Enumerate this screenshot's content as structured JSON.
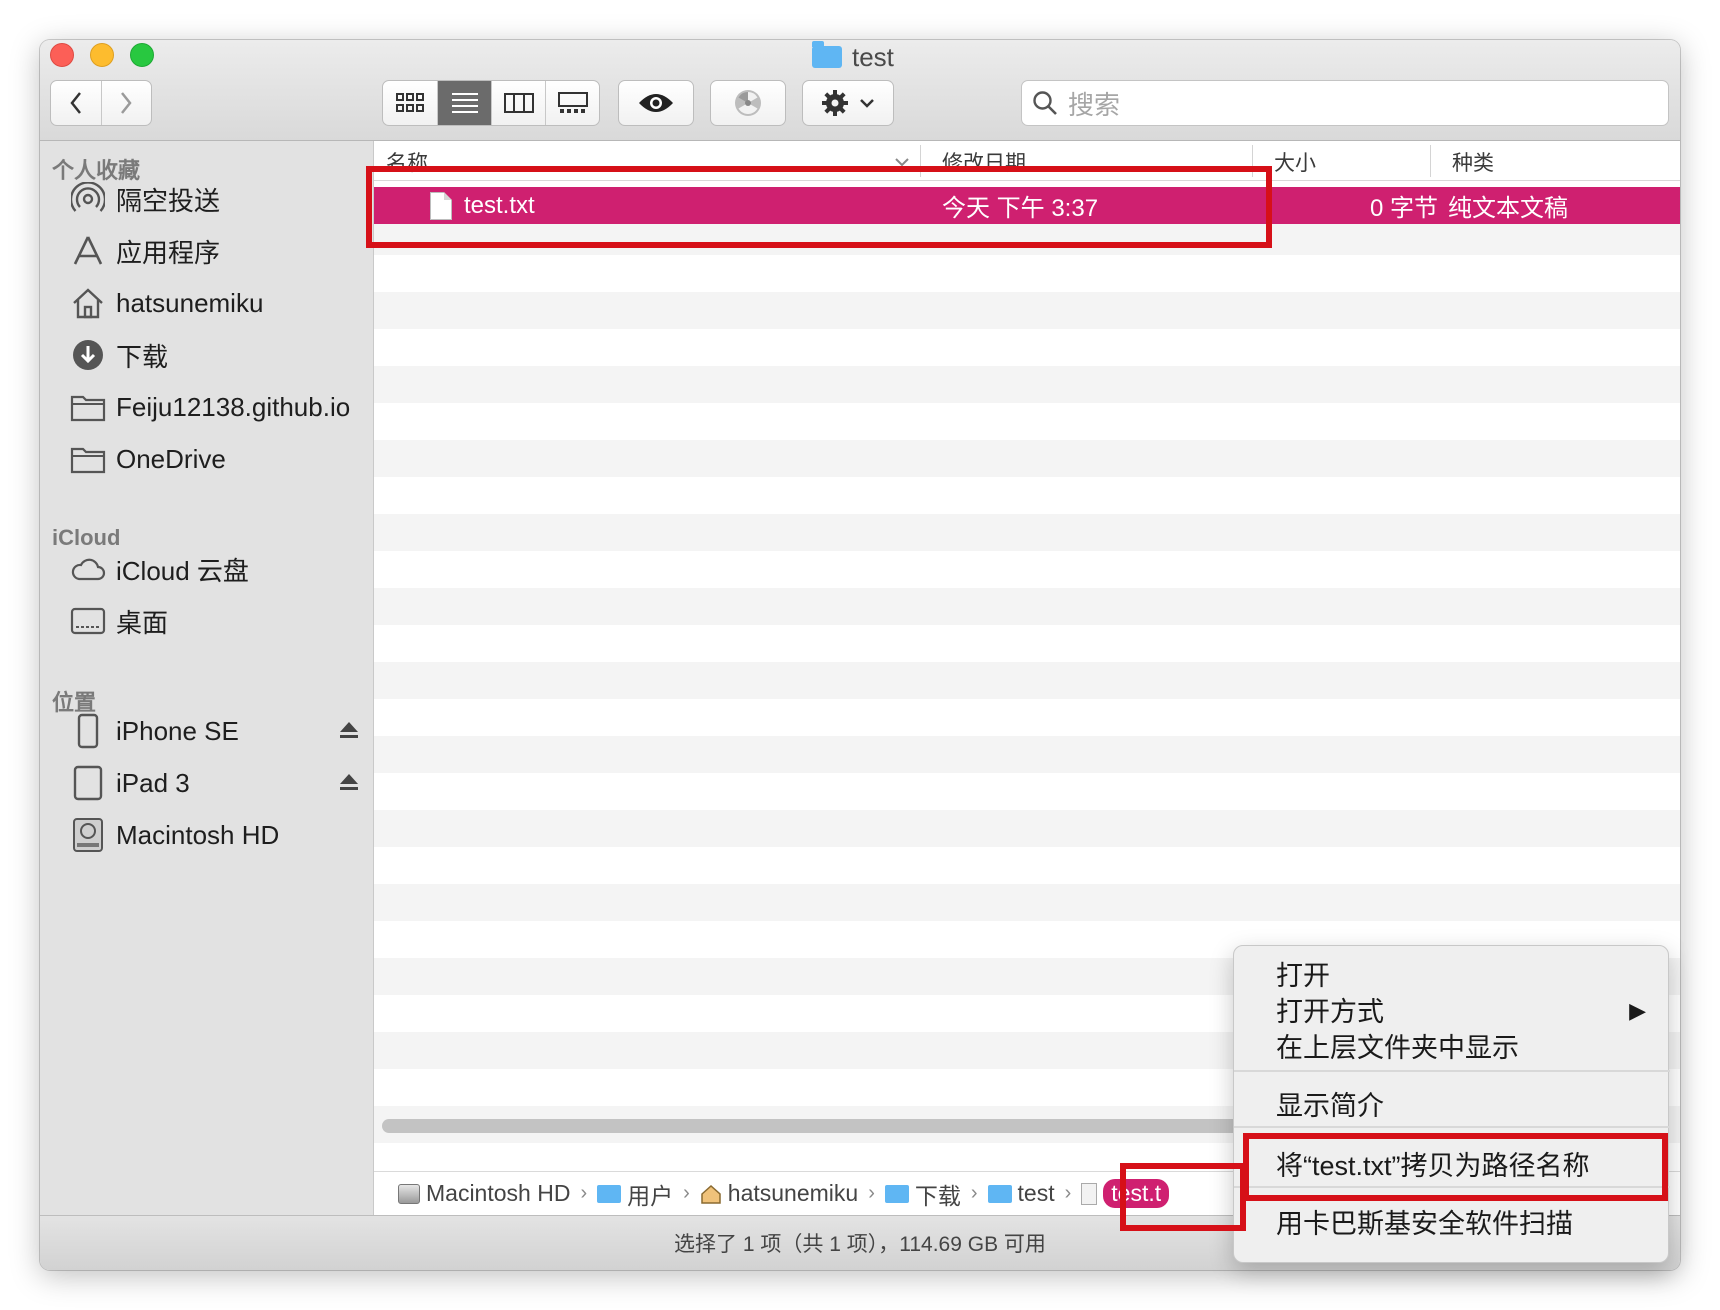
{
  "window": {
    "title": "test"
  },
  "toolbar": {
    "back_icon": "chevron-left-icon",
    "forward_icon": "chevron-right-icon",
    "view_modes": [
      "icon-view",
      "list-view",
      "column-view",
      "gallery-view"
    ],
    "active_view": "list-view",
    "search_placeholder": "搜索"
  },
  "sidebar": {
    "favorites_header": "个人收藏",
    "favorites": [
      {
        "label": "隔空投送",
        "icon": "airdrop-icon"
      },
      {
        "label": "应用程序",
        "icon": "applications-icon"
      },
      {
        "label": "hatsunemiku",
        "icon": "home-icon"
      },
      {
        "label": "下载",
        "icon": "downloads-icon"
      },
      {
        "label": "Feiju12138.github.io",
        "icon": "folder-icon"
      },
      {
        "label": "OneDrive",
        "icon": "folder-icon"
      }
    ],
    "icloud_header": "iCloud",
    "icloud": [
      {
        "label": "iCloud 云盘",
        "icon": "cloud-icon"
      },
      {
        "label": "桌面",
        "icon": "desktop-icon"
      }
    ],
    "locations_header": "位置",
    "locations": [
      {
        "label": "iPhone SE",
        "icon": "iphone-icon",
        "ejectable": true
      },
      {
        "label": "iPad 3",
        "icon": "ipad-icon",
        "ejectable": true
      },
      {
        "label": "Macintosh HD",
        "icon": "harddisk-icon",
        "ejectable": false
      }
    ]
  },
  "list": {
    "columns": {
      "name": "名称",
      "modified": "修改日期",
      "size": "大小",
      "kind": "种类"
    },
    "selected_file": {
      "name": "test.txt",
      "modified": "今天 下午 3:37",
      "size": "0 字节",
      "kind": "纯文本文稿"
    }
  },
  "pathbar": {
    "crumbs": [
      "Macintosh HD",
      "用户",
      "hatsunemiku",
      "下载",
      "test"
    ],
    "current": "test.t"
  },
  "statusbar": {
    "text": "选择了 1 项（共 1 项），114.69 GB 可用"
  },
  "context_menu": {
    "open": "打开",
    "open_with": "打开方式",
    "show_in_enclosing": "在上层文件夹中显示",
    "get_info": "显示简介",
    "copy_path": "将“test.txt”拷贝为路径名称",
    "kaspersky_scan": "用卡巴斯基安全软件扫描"
  },
  "colors": {
    "selection": "#cf2070",
    "highlight_annotation": "#d61018",
    "sidebar_bg": "#e2e2e2"
  }
}
